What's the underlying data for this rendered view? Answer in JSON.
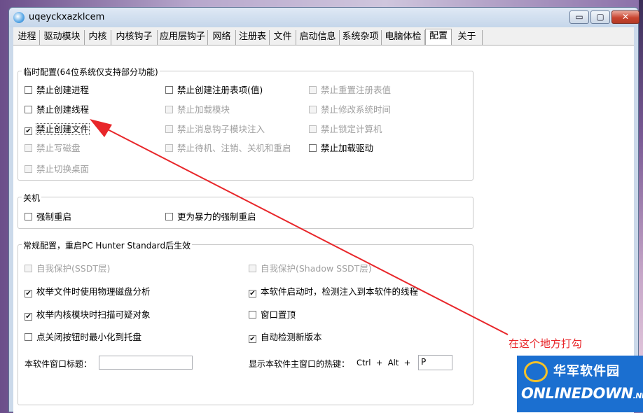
{
  "window": {
    "title": "uqeyckxazklcem",
    "min": "▭",
    "max": "▢",
    "close": "✕"
  },
  "tabs": [
    {
      "label": "进程"
    },
    {
      "label": "驱动模块"
    },
    {
      "label": "内核"
    },
    {
      "label": "内核钩子"
    },
    {
      "label": "应用层钩子"
    },
    {
      "label": "网络"
    },
    {
      "label": "注册表"
    },
    {
      "label": "文件"
    },
    {
      "label": "启动信息"
    },
    {
      "label": "系统杂项"
    },
    {
      "label": "电脑体检"
    },
    {
      "label": "配置"
    },
    {
      "label": "关于"
    }
  ],
  "active_tab": "配置",
  "temp_config": {
    "title": "临时配置(64位系统仅支持部分功能)",
    "items": [
      {
        "label": "禁止创建进程",
        "checked": false,
        "enabled": true
      },
      {
        "label": "禁止创建注册表项(值)",
        "checked": false,
        "enabled": true
      },
      {
        "label": "禁止重置注册表值",
        "checked": false,
        "enabled": false
      },
      {
        "label": "禁止创建线程",
        "checked": false,
        "enabled": true
      },
      {
        "label": "禁止加载模块",
        "checked": false,
        "enabled": false
      },
      {
        "label": "禁止修改系统时间",
        "checked": false,
        "enabled": false
      },
      {
        "label": "禁止创建文件",
        "checked": true,
        "enabled": true
      },
      {
        "label": "禁止消息钩子模块注入",
        "checked": false,
        "enabled": false
      },
      {
        "label": "禁止锁定计算机",
        "checked": false,
        "enabled": false
      },
      {
        "label": "禁止写磁盘",
        "checked": false,
        "enabled": false
      },
      {
        "label": "禁止待机、注销、关机和重启",
        "checked": false,
        "enabled": false
      },
      {
        "label": "禁止加载驱动",
        "checked": false,
        "enabled": true
      },
      {
        "label": "禁止切换桌面",
        "checked": false,
        "enabled": false
      }
    ]
  },
  "shutdown": {
    "title": "关机",
    "items": [
      {
        "label": "强制重启",
        "checked": false,
        "enabled": true
      },
      {
        "label": "更为暴力的强制重启",
        "checked": false,
        "enabled": true
      }
    ]
  },
  "general": {
    "title": "常规配置，重启PC Hunter Standard后生效",
    "items": [
      {
        "label": "自我保护(SSDT层)",
        "checked": false,
        "enabled": false
      },
      {
        "label": "自我保护(Shadow SSDT层)",
        "checked": false,
        "enabled": false
      },
      {
        "label": "枚举文件时使用物理磁盘分析",
        "checked": true,
        "enabled": true
      },
      {
        "label": "本软件启动时，检测注入到本软件的线程",
        "checked": true,
        "enabled": true
      },
      {
        "label": "枚举内核模块时扫描可疑对象",
        "checked": true,
        "enabled": true
      },
      {
        "label": "窗口置顶",
        "checked": false,
        "enabled": true
      },
      {
        "label": "点关闭按钮时最小化到托盘",
        "checked": false,
        "enabled": true
      },
      {
        "label": "自动检测新版本",
        "checked": true,
        "enabled": true
      }
    ],
    "window_title_label": "本软件窗口标题：",
    "window_title_value": "",
    "hotkey_label": "显示本软件主窗口的热键：",
    "hotkey_combo": "Ctrl  +  Alt  +",
    "hotkey_key": "P"
  },
  "annotation": {
    "text": "在这个地方打勾",
    "color": "#e8262a"
  },
  "watermark": {
    "line1": "华军软件园",
    "line2": "NLINEDOWN",
    "suffix": ".NET"
  }
}
